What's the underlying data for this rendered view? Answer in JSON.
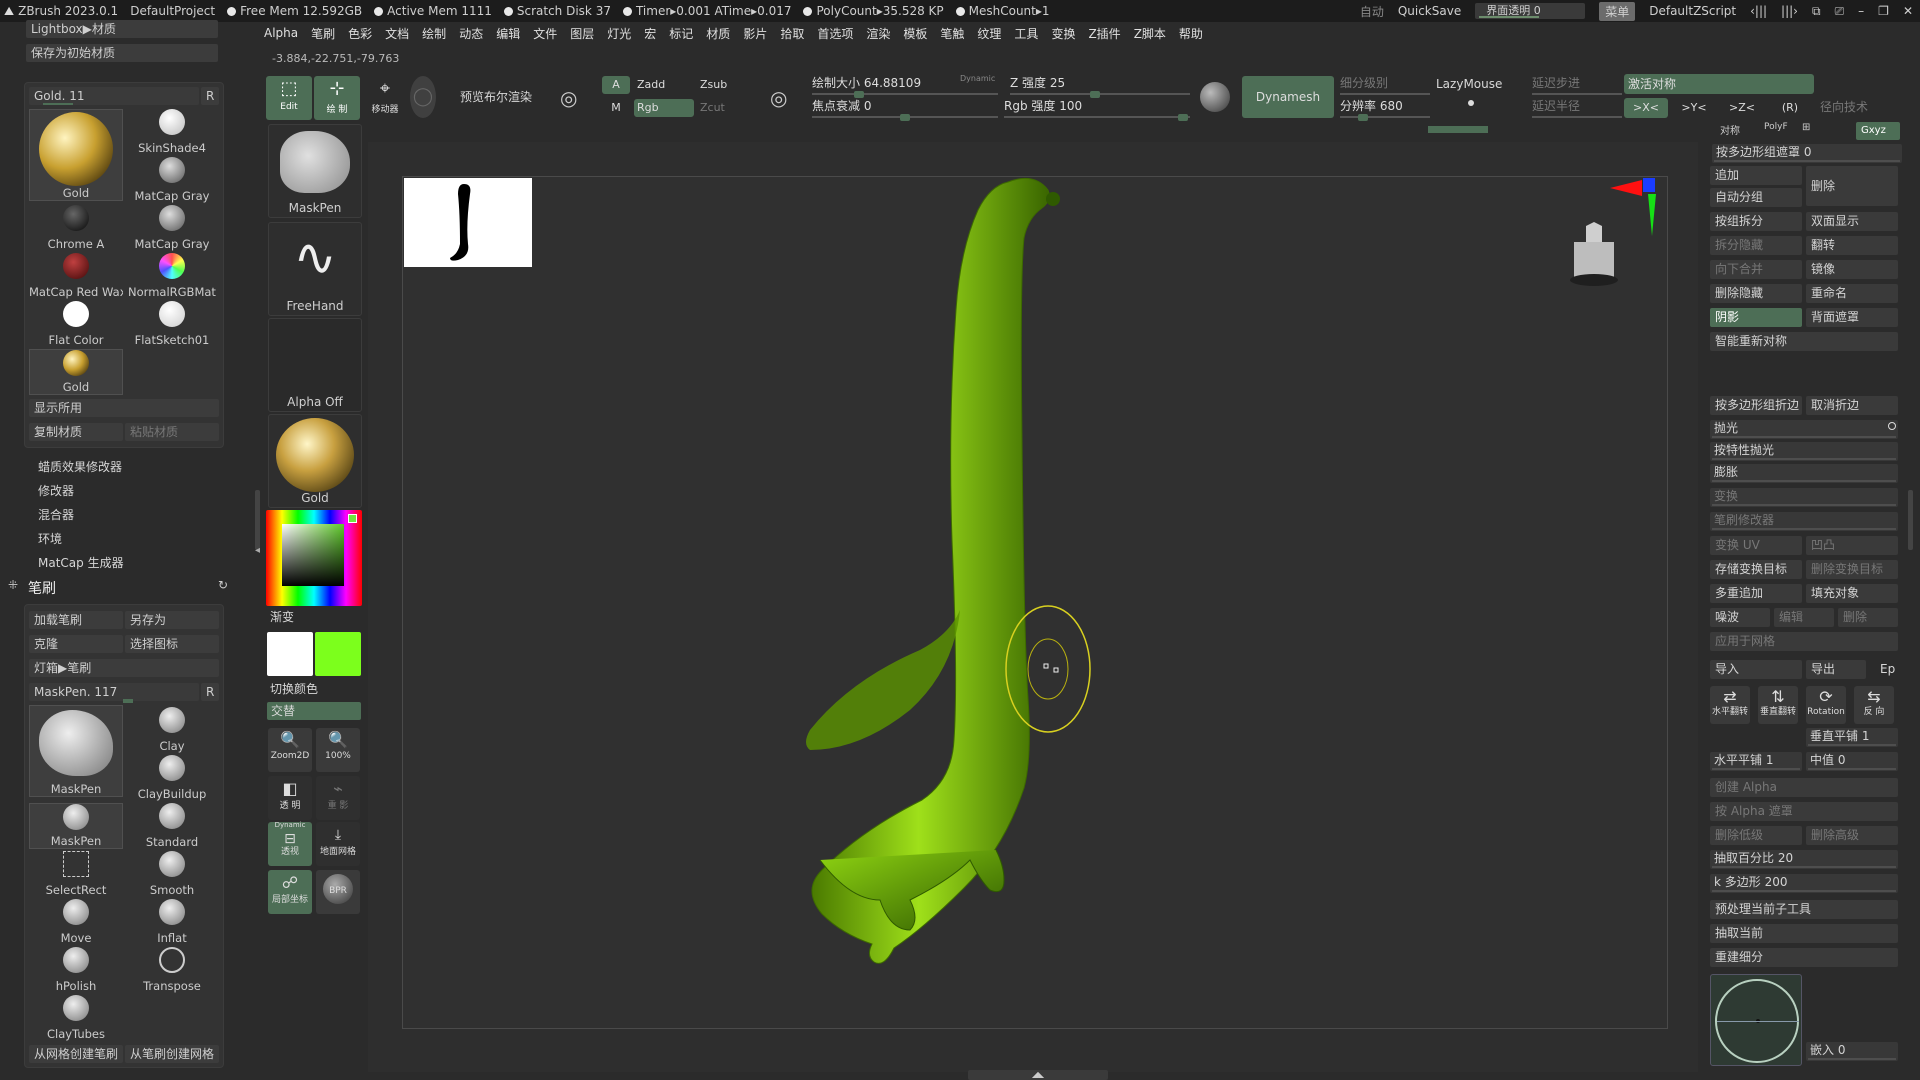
{
  "titlebar": {
    "app": "ZBrush 2023.0.1",
    "project": "DefaultProject",
    "free_mem": "Free Mem 12.592GB",
    "active_mem": "Active Mem 1111",
    "scratch_disk": "Scratch Disk 37",
    "timer": "Timer▸0.001 ATime▸0.017",
    "polycount": "PolyCount▸35.528 KP",
    "meshcount": "MeshCount▸1",
    "auto": "自动",
    "quicksave": "QuickSave",
    "ui_opacity": "界面透明 0",
    "menu_btn": "菜单",
    "script": "DefaultZScript"
  },
  "menubar": [
    "Alpha",
    "笔刷",
    "色彩",
    "文档",
    "绘制",
    "动态",
    "编辑",
    "文件",
    "图层",
    "灯光",
    "宏",
    "标记",
    "材质",
    "影片",
    "拾取",
    "首选项",
    "渲染",
    "模板",
    "笔触",
    "纹理",
    "工具",
    "变换",
    "Z插件",
    "Z脚本",
    "帮助"
  ],
  "coords": "-3.884,-22.751,-79.763",
  "left": {
    "lightbox_material": "Lightbox▶材质",
    "save_default": "保存为初始材质",
    "material_slider": "Gold. 11",
    "r": "R",
    "materials": [
      "Gold",
      "SkinShade4",
      "MatCap Gray",
      "Chrome A",
      "MatCap Gray",
      "MatCap Red Wax",
      "NormalRGBMat",
      "Flat Color",
      "FlatSketch01",
      "Gold"
    ],
    "show_used": "显示所用",
    "copy_mat": "复制材质",
    "paste_mat": "粘贴材质",
    "nav": [
      "蜡质效果修改器",
      "修改器",
      "混合器",
      "环境",
      "MatCap 生成器"
    ],
    "brush_header": "笔刷",
    "load_brush": "加载笔刷",
    "save_as": "另存为",
    "clone": "克隆",
    "select_icon": "选择图标",
    "lightbox_brush": "灯箱▶笔刷",
    "brush_slider": "MaskPen. 117",
    "brushes": [
      "MaskPen",
      "Clay",
      "ClayBuildup",
      "MaskPen",
      "Standard",
      "SelectRect",
      "Smooth",
      "Move",
      "Inflat",
      "hPolish",
      "Transpose",
      "ClayTubes"
    ],
    "from_mesh": "从网格创建笔刷",
    "from_brush": "从笔刷创建网格"
  },
  "toolcol": {
    "maskpen": "MaskPen",
    "freehand": "FreeHand",
    "alpha_off": "Alpha Off",
    "gold": "Gold",
    "gradient": "渐变",
    "switch_color": "切换颜色",
    "alternate": "交替",
    "zoom2d": "Zoom2D",
    "p100": "100%",
    "transparent": "透 明",
    "ghost": "重 影",
    "dynamic": "Dynamic",
    "persp": "透视",
    "floor": "地面网格",
    "local": "局部坐标",
    "bpr": "BPR",
    "primary_color": "#ffffff",
    "secondary_color": "#7cff1c"
  },
  "toolbar": {
    "edit": "Edit",
    "draw": "绘 制",
    "move": "移动器",
    "preview_bool": "预览布尔渲染",
    "a": "A",
    "zadd": "Zadd",
    "zsub": "Zsub",
    "m": "M",
    "rgb": "Rgb",
    "zcut": "Zcut",
    "draw_size": "绘制大小 64.88109",
    "dynamic": "Dynamic",
    "focal": "焦点衰减 0",
    "z_intensity": "Z 强度 25",
    "rgb_intensity": "Rgb 强度 100",
    "dynamesh": "Dynamesh",
    "sub_levels": "细分级别",
    "resolution": "分辨率 680",
    "lazymouse": "LazyMouse",
    "lazy_step": "延迟步进",
    "lazy_radius": "延迟半径",
    "activate_sym": "激活对称",
    "x": ">X<",
    "y": ">Y<",
    "z": ">Z<",
    "r": "(R)",
    "radial": "径向技术",
    "sym": "对称",
    "polyf": "PolyF",
    "xyz": "Gxyz"
  },
  "right": {
    "mask_by_group": "按多边形组遮罩 0",
    "append": "追加",
    "delete": "删除",
    "auto_group": "自动分组",
    "split_group": "按组拆分",
    "double": "双面显示",
    "split_hidden": "拆分隐藏",
    "flip": "翻转",
    "merge_down": "向下合并",
    "mirror": "镜像",
    "del_hidden": "删除隐藏",
    "rename": "重命名",
    "shadow": "阴影",
    "back_mask": "背面遮罩",
    "smart_resym": "智能重新对称",
    "crease_pg": "按多边形组折边",
    "uncrease": "取消折边",
    "polish": "抛光",
    "polish_feat": "按特性抛光",
    "inflate": "膨胀",
    "deform": "变换",
    "brush_mod": "笔刷修改器",
    "uv_deform": "变换 UV",
    "bump": "凹凸",
    "store_morph": "存储变换目标",
    "del_morph": "删除变换目标",
    "multi_append": "多重追加",
    "fill": "填充对象",
    "noise": "噪波",
    "edit": "编辑",
    "delete2": "删除",
    "apply_mesh": "应用于网格",
    "import": "导入",
    "export": "导出",
    "ep": "Ep",
    "h_tile": "水平平铺 1",
    "v_tile": "垂直平铺 1",
    "mid": "中值 0",
    "create_alpha": "创建 Alpha",
    "mask_alpha": "按 Alpha 遮罩",
    "del_lower": "删除低级",
    "del_higher": "删除高级",
    "decimate_pct": "抽取百分比 20",
    "k_poly": "k 多边形 200",
    "preprocess": "预处理当前子工具",
    "decimate_cur": "抽取当前",
    "rebuild": "重建细分",
    "embed": "嵌入 0",
    "icons": [
      "水平翻转",
      "垂直翻转",
      "Rotation",
      "反 向"
    ]
  },
  "colors": {
    "accent": "#4d6e56",
    "model": "#7cc000"
  }
}
